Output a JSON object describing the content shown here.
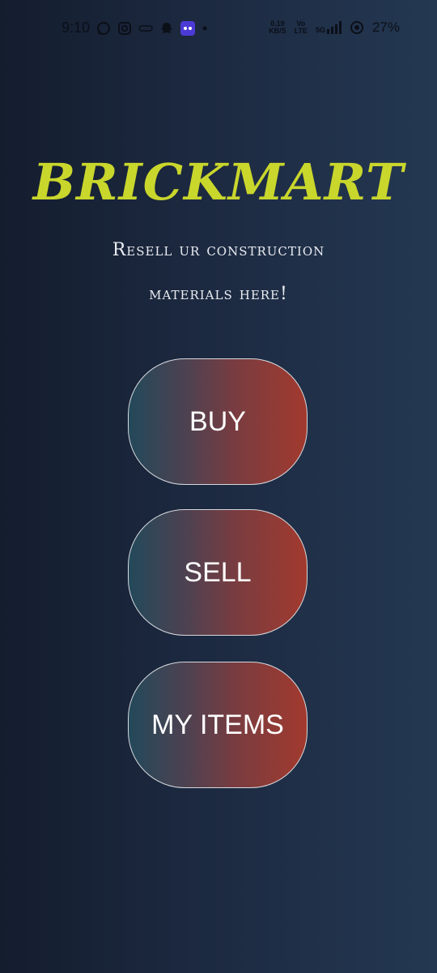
{
  "status_bar": {
    "time": "9:10",
    "icons_left": [
      "whatsapp-icon",
      "instagram-icon",
      "link-icon",
      "snapchat-icon",
      "discord-icon",
      "dot-icon"
    ],
    "speed": "0.19",
    "speed_unit": "KB/S",
    "volte_top": "Vo",
    "volte_bottom": "LTE",
    "network": "5G",
    "battery": "27%"
  },
  "app": {
    "title": "BRICKMART",
    "subtitle_line1": "Resell ur construction",
    "subtitle_line2": "materials here!"
  },
  "buttons": {
    "buy": "BUY",
    "sell": "SELL",
    "my_items": "MY ITEMS"
  },
  "colors": {
    "title": "#c9d62c",
    "bg_left": "#141d2e",
    "bg_right": "#243852",
    "button_left": "#23495a",
    "button_right": "#a23a2e"
  }
}
